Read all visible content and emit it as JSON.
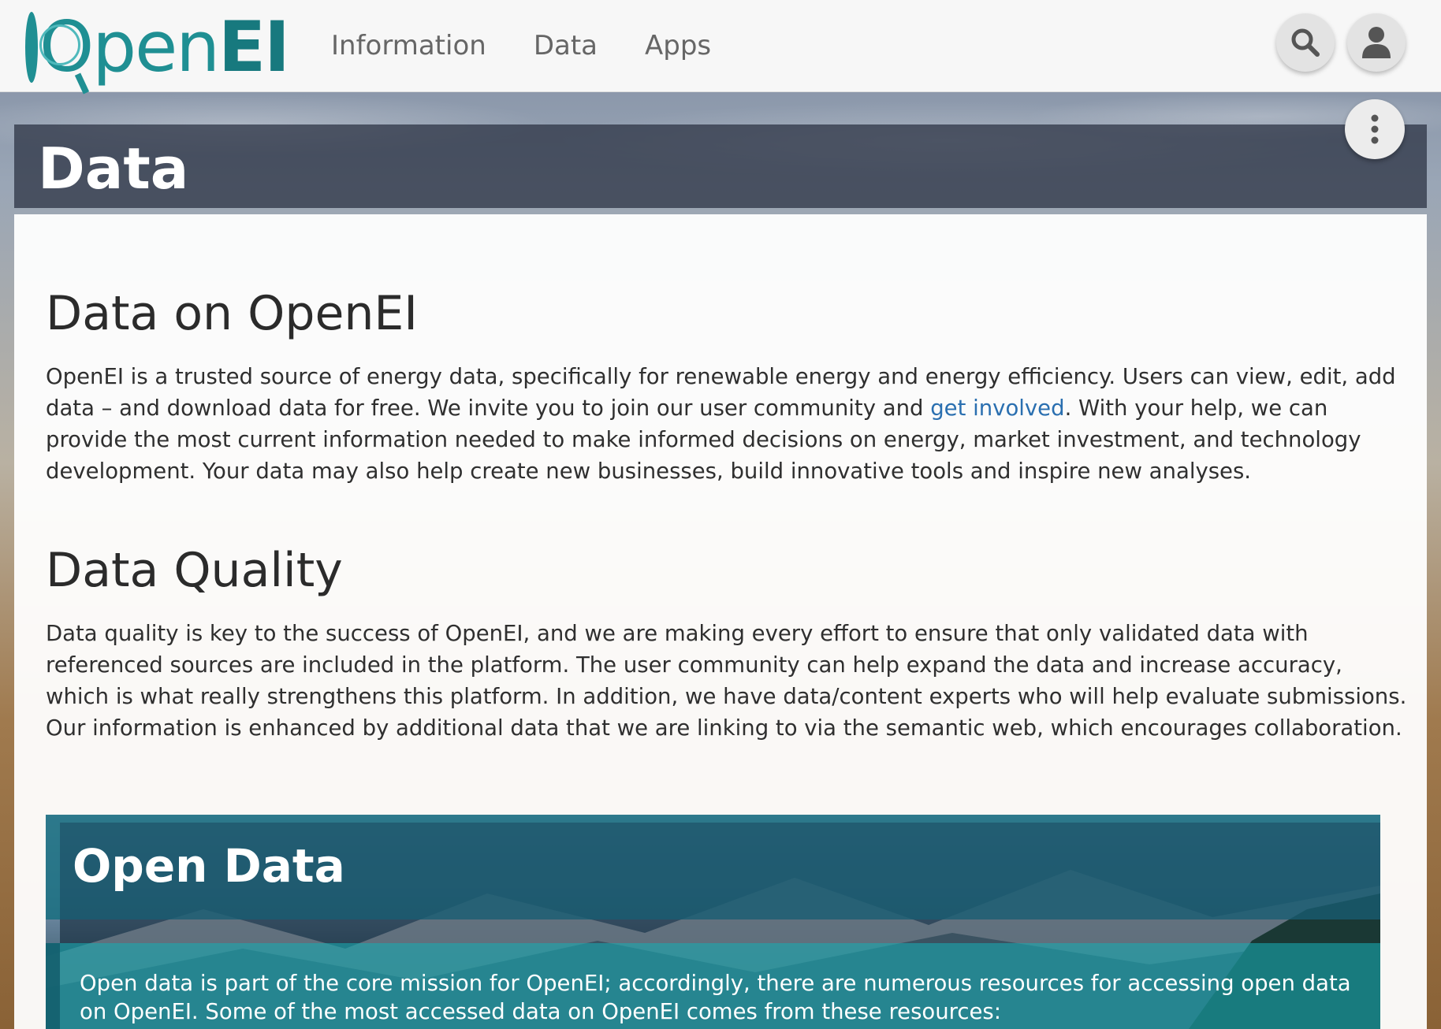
{
  "topbar": {
    "logo_text_a": "Open",
    "logo_text_b": "EI",
    "nav": [
      "Information",
      "Data",
      "Apps"
    ]
  },
  "icons": {
    "search": "search-icon",
    "user": "user-icon",
    "more": "more-vertical-icon"
  },
  "page": {
    "title": "Data"
  },
  "sections": {
    "data_on_openei": {
      "heading": "Data on OpenEI",
      "text_before": "OpenEI is a trusted source of energy data, specifically for renewable energy and energy efficiency. Users can view, edit, add data – and download data for free. We invite you to join our user community and ",
      "link": "get involved",
      "text_after": ". With your help, we can provide the most current information needed to make informed decisions on energy, market investment, and technology development. Your data may also help create new businesses, build innovative tools and inspire new analyses."
    },
    "data_quality": {
      "heading": "Data Quality",
      "text": "Data quality is key to the success of OpenEI, and we are making every effort to ensure that only validated data with referenced sources are included in the platform. The user community can help expand the data and increase accuracy, which is what really strengthens this platform. In addition, we have data/content experts who will help evaluate submissions. Our information is enhanced by additional data that we are linking to via the semantic web, which encourages collaboration."
    },
    "open_data": {
      "heading": "Open Data",
      "text": "Open data is part of the core mission for OpenEI; accordingly, there are numerous resources for accessing open data on OpenEI. Some of the most accessed data on OpenEI comes from these resources:"
    }
  },
  "colors": {
    "brand_teal": "#1f8f93",
    "link_blue": "#2a6fb0",
    "header_overlay": "#282f40",
    "open_data_teal": "#14828c"
  }
}
